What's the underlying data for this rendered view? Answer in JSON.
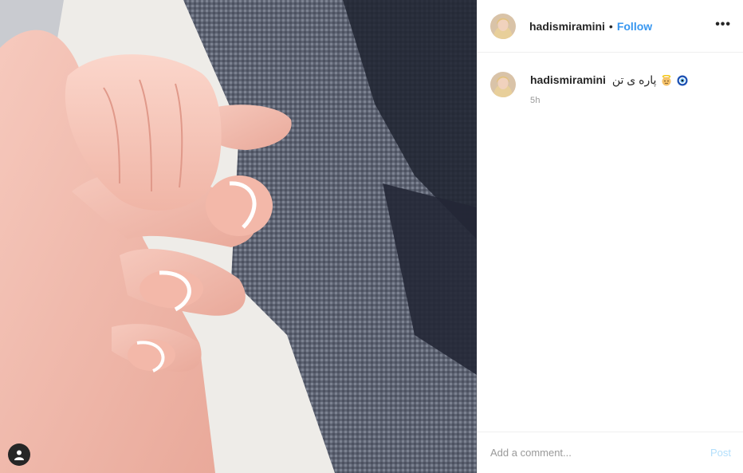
{
  "post": {
    "image_icon": "photo-of-baby-holding-finger"
  },
  "header": {
    "username": "hadismiramini",
    "separator": "•",
    "follow_label": "Follow",
    "more_label": "•••"
  },
  "caption": {
    "username": "hadismiramini",
    "text": "پاره ی تن",
    "emojis": [
      "baby-angel-emoji",
      "nazar-amulet-emoji"
    ],
    "time": "5h"
  },
  "comment_bar": {
    "placeholder": "Add a comment...",
    "post_label": "Post"
  },
  "colors": {
    "link_blue": "#3897f0",
    "post_disabled": "#b2dffc",
    "border": "#efefef",
    "muted_text": "#999999"
  }
}
